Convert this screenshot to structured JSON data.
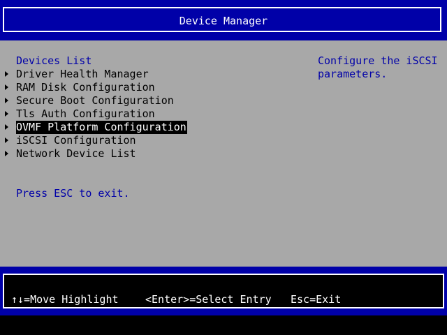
{
  "header": {
    "title": "Device Manager"
  },
  "main": {
    "section_title": "Devices List",
    "items": [
      {
        "label": "Driver Health Manager"
      },
      {
        "label": "RAM Disk Configuration"
      },
      {
        "label": "Secure Boot Configuration"
      },
      {
        "label": "Tls Auth Configuration"
      },
      {
        "label": "OVMF Platform Configuration",
        "selected": true
      },
      {
        "label": "iSCSI Configuration"
      },
      {
        "label": "Network Device List"
      }
    ],
    "exit_hint": "Press ESC to exit.",
    "help_text_line1": "Configure the iSCSI",
    "help_text_line2": "parameters."
  },
  "footer": {
    "move_hint": "↑↓=Move Highlight",
    "select_hint": "<Enter>=Select Entry",
    "exit_hint": "Esc=Exit"
  },
  "colors": {
    "header_bg": "#0000a8",
    "panel_bg": "#a8a8a8",
    "text_blue": "#0000a8",
    "highlight_bg": "#000000",
    "highlight_fg": "#ffffff"
  }
}
